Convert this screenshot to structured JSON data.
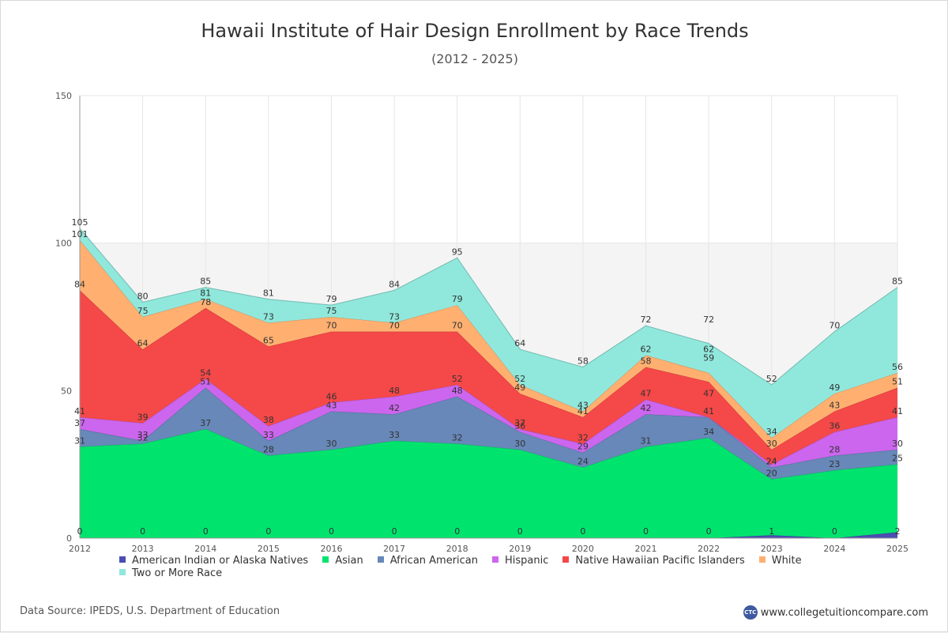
{
  "chart_data": {
    "type": "area",
    "stacked": true,
    "title": "Hawaii Institute of Hair Design Enrollment by Race Trends",
    "subtitle": "(2012 - 2025)",
    "x": [
      "2012",
      "2013",
      "2014",
      "2015",
      "2016",
      "2017",
      "2018",
      "2019",
      "2020",
      "2021",
      "2022",
      "2023",
      "2024",
      "2025"
    ],
    "ylim": [
      0,
      150
    ],
    "yticks": [
      0,
      50,
      100,
      150
    ],
    "grid": true,
    "legend_position": "bottom",
    "series": [
      {
        "name": "American Indian or Alaska Natives",
        "color": "#4d4db3",
        "values": [
          0,
          0,
          0,
          0,
          0,
          0,
          0,
          0,
          0,
          0,
          0,
          1,
          0,
          2
        ]
      },
      {
        "name": "Asian",
        "color": "#00e46e",
        "values": [
          31,
          32,
          37,
          28,
          30,
          33,
          32,
          30,
          24,
          31,
          34,
          19,
          23,
          23
        ]
      },
      {
        "name": "African American",
        "color": "#6788b8",
        "values": [
          6,
          1,
          14,
          5,
          13,
          9,
          16,
          6,
          5,
          11,
          7,
          4,
          5,
          5
        ]
      },
      {
        "name": "Hispanic",
        "color": "#cc66ee",
        "values": [
          4,
          6,
          3,
          5,
          3,
          6,
          4,
          1,
          3,
          5,
          0,
          1,
          8,
          11
        ]
      },
      {
        "name": "Native Hawaiian Pacific Islanders",
        "color": "#f54848",
        "values": [
          43,
          25,
          24,
          27,
          24,
          22,
          18,
          12,
          9,
          11,
          12,
          5,
          7,
          10
        ]
      },
      {
        "name": "White",
        "color": "#ffb071",
        "values": [
          17,
          11,
          3,
          8,
          5,
          3,
          9,
          3,
          2,
          4,
          3,
          4,
          6,
          5
        ]
      },
      {
        "name": "Two or More Race",
        "color": "#90e8dc",
        "values": [
          4,
          5,
          4,
          8,
          4,
          11,
          16,
          12,
          15,
          10,
          10,
          18,
          21,
          29
        ]
      }
    ],
    "labels": [
      [
        0,
        0,
        0,
        0,
        0,
        0,
        0,
        0,
        0,
        0,
        0,
        1,
        0,
        2
      ],
      [
        31,
        32,
        37,
        28,
        30,
        33,
        32,
        30,
        24,
        31,
        34,
        20,
        23,
        25
      ],
      [
        37,
        33,
        51,
        33,
        43,
        42,
        48,
        36,
        29,
        42,
        41,
        24,
        28,
        30
      ],
      [
        41,
        39,
        54,
        38,
        46,
        48,
        52,
        37,
        32,
        47,
        47,
        24,
        36,
        41
      ],
      [
        84,
        64,
        78,
        65,
        70,
        70,
        70,
        49,
        41,
        58,
        59,
        30,
        43,
        51
      ],
      [
        101,
        75,
        81,
        73,
        75,
        73,
        79,
        52,
        43,
        62,
        62,
        34,
        49,
        56
      ],
      [
        105,
        80,
        85,
        81,
        79,
        84,
        95,
        64,
        58,
        72,
        72,
        52,
        70,
        85
      ]
    ]
  },
  "footer": {
    "source": "Data Source: IPEDS, U.S. Department of Education",
    "logo_text": "CTC",
    "site": "www.collegetuitioncompare.com"
  }
}
